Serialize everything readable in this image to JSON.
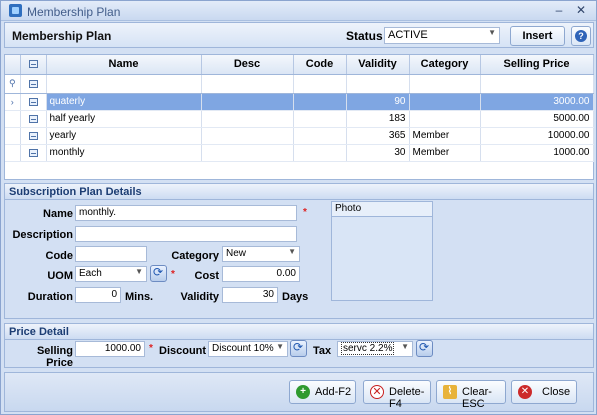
{
  "window": {
    "title": "Membership Plan",
    "min_glyph": "–",
    "close_glyph": "✕"
  },
  "header": {
    "title": "Membership Plan",
    "status_label": "Status",
    "status_value": "ACTIVE",
    "insert_label": "Insert",
    "help_glyph": "?"
  },
  "grid": {
    "columns": [
      "Name",
      "Desc",
      "Code",
      "Validity",
      "Category",
      "Selling Price"
    ],
    "rows": [
      {
        "name": "quaterly",
        "desc": "",
        "code": "",
        "validity": "90",
        "category": "",
        "price": "3000.00"
      },
      {
        "name": "half yearly",
        "desc": "",
        "code": "",
        "validity": "183",
        "category": "",
        "price": "5000.00"
      },
      {
        "name": "yearly",
        "desc": "",
        "code": "",
        "validity": "365",
        "category": "Member",
        "price": "10000.00"
      },
      {
        "name": "monthly",
        "desc": "",
        "code": "",
        "validity": "30",
        "category": "Member",
        "price": "1000.00"
      }
    ],
    "selected_indicator": "›"
  },
  "details": {
    "heading": "Subscription Plan Details",
    "name_label": "Name",
    "name_value": "monthly.",
    "desc_label": "Description",
    "desc_value": "",
    "code_label": "Code",
    "code_value": "",
    "category_label": "Category",
    "category_value": "New",
    "uom_label": "UOM",
    "uom_value": "Each",
    "cost_label": "Cost",
    "cost_value": "0.00",
    "duration_label": "Duration",
    "duration_value": "0",
    "duration_unit": "Mins.",
    "validity_label": "Validity",
    "validity_value": "30",
    "validity_unit": "Days",
    "photo_label": "Photo",
    "required_mark": "*"
  },
  "price": {
    "heading": "Price Detail",
    "selling_label": "Selling Price",
    "selling_value": "1000.00",
    "discount_label": "Discount",
    "discount_value": "Discount 10%",
    "tax_label": "Tax",
    "tax_value": "servc 2.2%"
  },
  "footer": {
    "add_label": "Add-F2",
    "delete_label": "Delete-F4",
    "clear_label": "Clear-ESC",
    "close_label": "Close"
  },
  "colors": {
    "selected_row": "#7fa6e2",
    "accent": "#2e63b8",
    "required": "#dd2222"
  }
}
